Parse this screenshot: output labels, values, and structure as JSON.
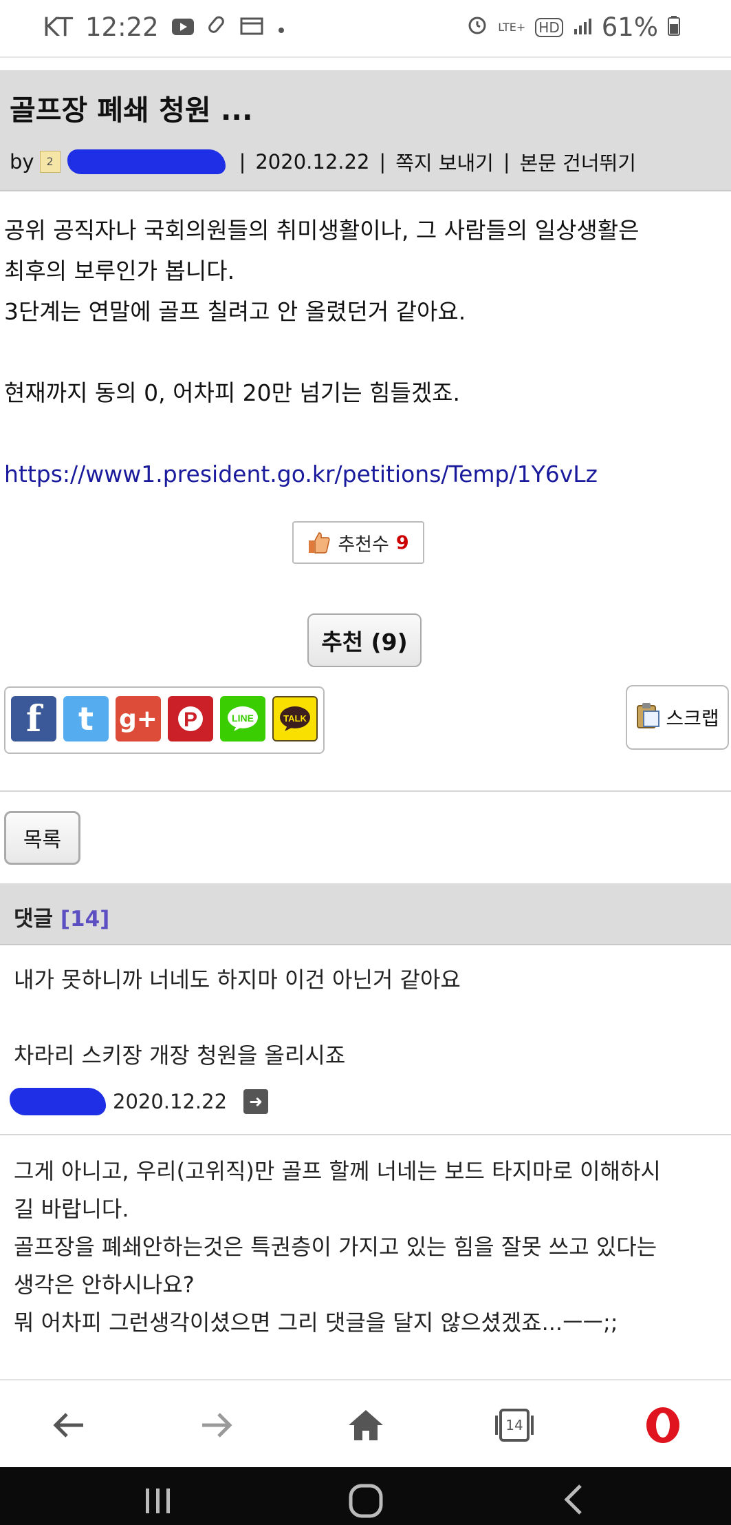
{
  "status_bar": {
    "carrier": "KT",
    "time": "12:22",
    "network": "LTE+",
    "hd": "HD",
    "battery": "61%"
  },
  "post": {
    "title": "골프장 폐쇄 청원 ...",
    "by_label": "by",
    "date": "2020.12.22",
    "message_link": "쪽지 보내기",
    "skip_link": "본문 건너뛰기",
    "body": [
      "공위 공직자나 국회의원들의 취미생활이나, 그 사람들의 일상생활은",
      "최후의 보루인가 봅니다.",
      "3단계는 연말에 골프 칠려고 안 올렸던거 같아요.",
      "",
      "현재까지 동의 0, 어차피 20만 넘기는 힘들겠죠.",
      "",
      ""
    ],
    "link": "https://www1.president.go.kr/petitions/Temp/1Y6vLz",
    "rec_count_label": "추천수",
    "rec_count": "9",
    "rec_button": "추천 (9)",
    "scrap_label": "스크랩",
    "list_button": "목록"
  },
  "share": [
    {
      "name": "facebook",
      "glyph": "f",
      "color": "#3b5998"
    },
    {
      "name": "twitter",
      "glyph": "t",
      "color": "#55acee"
    },
    {
      "name": "googleplus",
      "glyph": "g+",
      "color": "#dd4b39"
    },
    {
      "name": "pinterest",
      "glyph": "P",
      "color": "#cb2027"
    },
    {
      "name": "line",
      "glyph": "LINE",
      "color": "#3acd01"
    },
    {
      "name": "kakaotalk",
      "glyph": "TALK",
      "color": "#f9e000"
    }
  ],
  "comments": {
    "label": "댓글",
    "count": "[14]",
    "items": [
      {
        "lines": [
          "내가 못하니까 너네도 하지마 이건 아닌거 같아요",
          "",
          "차라리 스키장 개장 청원을 올리시죠"
        ],
        "date": "2020.12.22"
      },
      {
        "lines": [
          "그게 아니고, 우리(고위직)만 골프 할께 너네는 보드 타지마로 이해하시",
          "길 바랍니다.",
          "골프장을 폐쇄안하는것은 특권층이 가지고 있는 힘을 잘못 쓰고 있다는",
          "생각은 안하시나요?",
          "뭐 어차피 그런생각이셨으면 그리 댓글을 달지 않으셨겠죠...ㅡㅡ;;"
        ]
      }
    ]
  },
  "browser_bar": {
    "tab_count": "14"
  },
  "colors": {
    "header_bg": "#dcdcdc",
    "link": "#1a1a9c",
    "comment_count": "#5b4fc2",
    "rec_number": "#cc0000",
    "opera_red": "#e0141e"
  }
}
